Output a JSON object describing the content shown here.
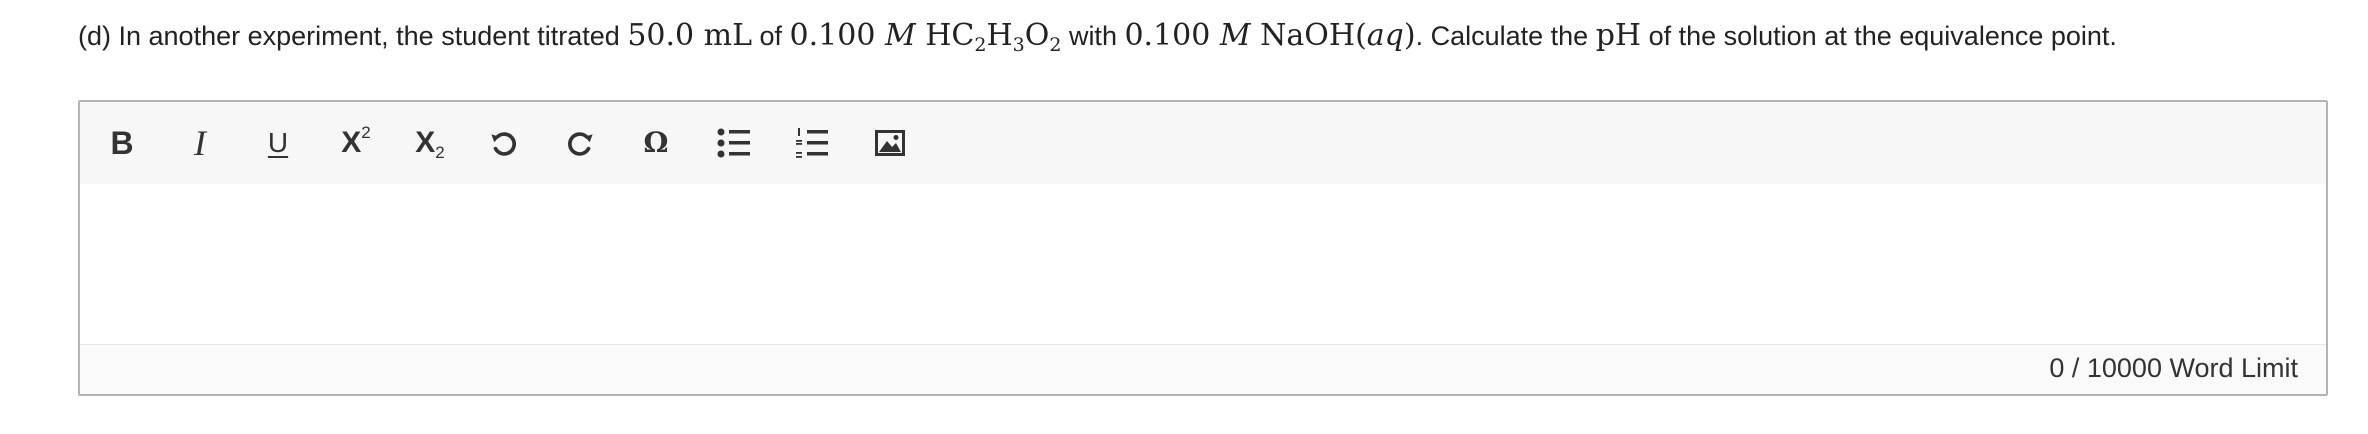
{
  "question": {
    "prefix": "(d) In another experiment, the student titrated ",
    "volume": "50.0 mL",
    "of1": " of ",
    "conc1": "0.100",
    "molar1": "M",
    "acid_hc": "HC",
    "acid_sub1": "2",
    "acid_h": "H",
    "acid_sub2": "3",
    "acid_o": "O",
    "acid_sub3": "2",
    "with": " with ",
    "conc2": "0.100",
    "molar2": "M",
    "base": "NaOH(",
    "base_aq": "aq",
    "base_close": ")",
    "middle": ". Calculate the ",
    "ph": "pH",
    "suffix": " of the solution at the equivalence point."
  },
  "toolbar": {
    "bold_label": "B",
    "italic_label": "I",
    "underline_label": "U",
    "superscript_base": "X",
    "superscript_exp": "2",
    "subscript_base": "X",
    "subscript_sub": "2",
    "special_char_label": "Ω",
    "icons": [
      "bold-icon",
      "italic-icon",
      "underline-icon",
      "superscript-icon",
      "subscript-icon",
      "undo-icon",
      "redo-icon",
      "special-character-icon",
      "bulleted-list-icon",
      "numbered-list-icon",
      "insert-image-icon"
    ]
  },
  "editor": {
    "value": ""
  },
  "footer": {
    "word_count": "0",
    "separator": " / ",
    "word_limit": "10000",
    "limit_label": " Word Limit"
  },
  "colors": {
    "toolbar_bg": "#f7f7f7",
    "border": "#b4b4b4",
    "text": "#222222",
    "icon": "#333333"
  }
}
